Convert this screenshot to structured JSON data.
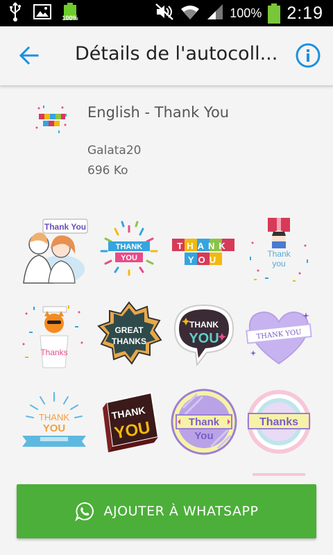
{
  "status_bar": {
    "battery_small_label": "100%",
    "battery_percent": "100%",
    "time": "2:19"
  },
  "app_bar": {
    "title": "Détails de l'autocoll..."
  },
  "pack": {
    "name": "English - Thank You",
    "author": "Galata20",
    "size": "696 Ko"
  },
  "stickers": [
    {
      "id": "couple-thank-you",
      "text": "Thank You"
    },
    {
      "id": "confetti-thank-you",
      "text": [
        "THANK",
        "YOU"
      ]
    },
    {
      "id": "blocks-thank-you",
      "text": [
        "THANK",
        "YOU"
      ]
    },
    {
      "id": "gift-thank-you",
      "text": [
        "Thank",
        "you"
      ]
    },
    {
      "id": "cat-thanks",
      "text": "Thanks"
    },
    {
      "id": "badge-great-thanks",
      "text": [
        "GREAT",
        "THANKS"
      ]
    },
    {
      "id": "bubble-thank-you",
      "text": [
        "THANK",
        "YOU"
      ]
    },
    {
      "id": "heart-thank-you",
      "text": "THANK YOU"
    },
    {
      "id": "banner-thank-you",
      "text": [
        "THANK",
        "YOU"
      ]
    },
    {
      "id": "3d-thank-you",
      "text": [
        "THANK",
        "YOU"
      ]
    },
    {
      "id": "circle-thank-you",
      "text": [
        "Thank",
        "You"
      ]
    },
    {
      "id": "circle-thanks",
      "text": "Thanks"
    }
  ],
  "actions": {
    "add_label": "AJOUTER À WHATSAPP"
  },
  "colors": {
    "accent_blue": "#1e8fe0",
    "button_green": "#4caf39",
    "status_bar_bg": "#000000",
    "battery_green": "#6ecb2c"
  },
  "icons": {
    "back": "arrow-left-icon",
    "info": "info-circle-icon",
    "whatsapp": "whatsapp-icon"
  }
}
